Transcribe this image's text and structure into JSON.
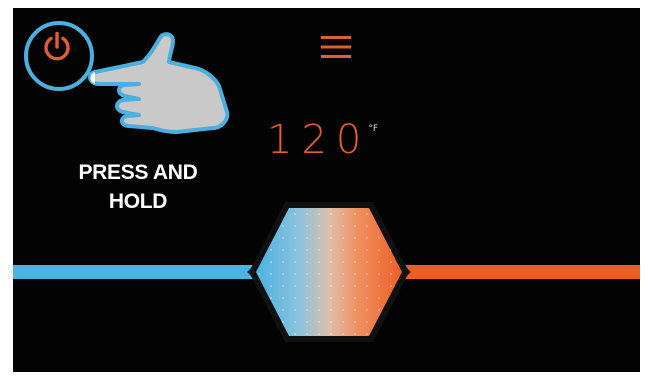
{
  "header": {
    "power_icon": "power-icon",
    "menu_icon": "hamburger-menu-icon"
  },
  "temperature": {
    "value": "120",
    "unit": "°F"
  },
  "instruction": {
    "line1": "PRESS AND",
    "line2": "HOLD"
  },
  "colors": {
    "background": "#030303",
    "accent_orange": "#e35d2e",
    "accent_blue": "#4ab4e2",
    "highlight_ring": "#49b0e0"
  }
}
